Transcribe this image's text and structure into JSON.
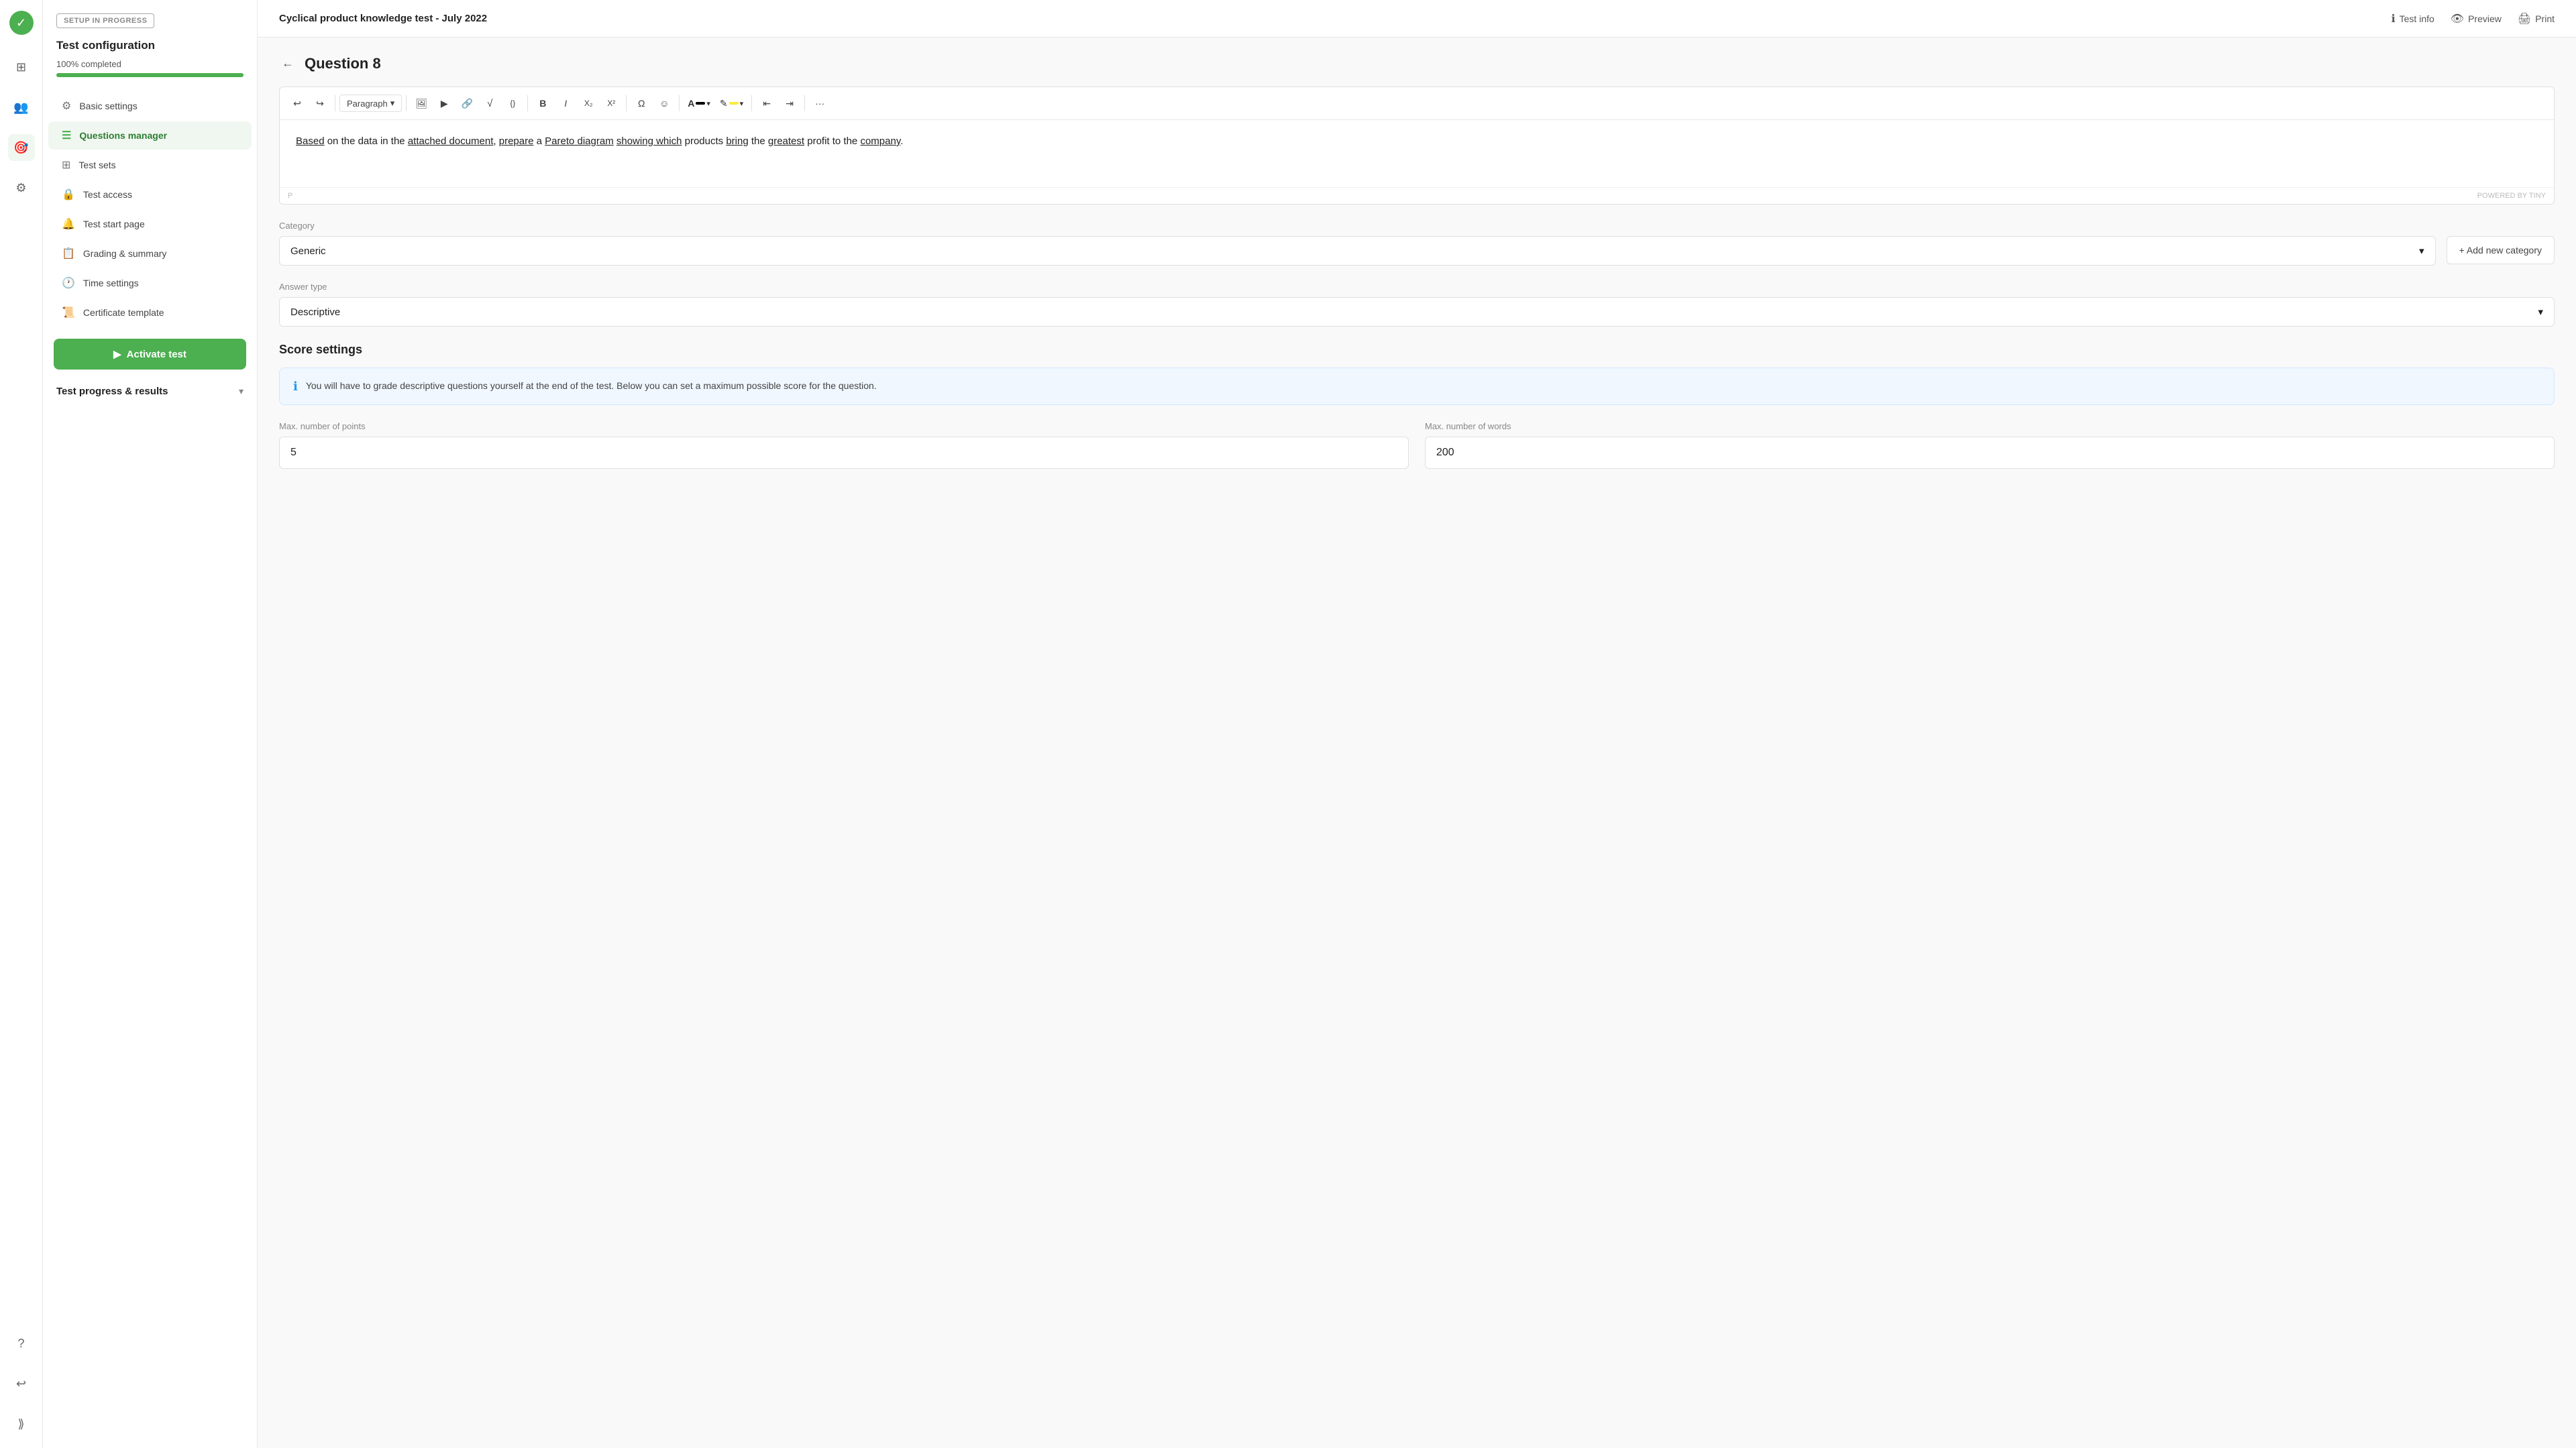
{
  "app": {
    "logo_symbol": "✓",
    "title": "Cyclical product knowledge test - July 2022"
  },
  "header": {
    "test_info_label": "Test info",
    "preview_label": "Preview",
    "print_label": "Print"
  },
  "sidebar": {
    "setup_badge": "SETUP IN PROGRESS",
    "config_title": "Test configuration",
    "progress_label": "100% completed",
    "progress_percent": 100,
    "nav_items": [
      {
        "id": "basic-settings",
        "label": "Basic settings",
        "icon": "⚙"
      },
      {
        "id": "questions-manager",
        "label": "Questions manager",
        "icon": "☰",
        "active": true
      },
      {
        "id": "test-sets",
        "label": "Test sets",
        "icon": "⊞"
      },
      {
        "id": "test-access",
        "label": "Test access",
        "icon": "🔒"
      },
      {
        "id": "test-start-page",
        "label": "Test start page",
        "icon": "🔔"
      },
      {
        "id": "grading-summary",
        "label": "Grading & summary",
        "icon": "📋"
      },
      {
        "id": "time-settings",
        "label": "Time settings",
        "icon": "🕐"
      },
      {
        "id": "certificate-template",
        "label": "Certificate template",
        "icon": "📜"
      }
    ],
    "activate_btn": "Activate test",
    "results_section": "Test progress & results"
  },
  "icons": {
    "grid": "⊞",
    "users": "👥",
    "gauge": "🎯",
    "gear": "⚙",
    "help": "?",
    "arrow_left": "←",
    "chevron_down": "▾",
    "chevron_up": "▴",
    "play": "▶",
    "expand_arrows": "⟪⟫",
    "undo": "↩",
    "redo": "↪",
    "image": "🖼",
    "video": "▶",
    "link": "🔗",
    "sqrt": "√",
    "code": "{}",
    "bold": "B",
    "italic": "I",
    "subscript": "X₂",
    "superscript": "X²",
    "omega": "Ω",
    "emoji": "☺",
    "font_color": "A",
    "highlight": "✎",
    "indent_left": "⇤",
    "indent_right": "⇥",
    "more": "···",
    "info": "ℹ",
    "plus": "+",
    "back": "←"
  },
  "question": {
    "number": "Question 8",
    "content": "Based on the data in the attached document, prepare a Pareto diagram showing which products bring the greatest profit to the company.",
    "editor_footer_left": "P",
    "editor_footer_right": "POWERED BY TINY",
    "cursor_visible": true
  },
  "form": {
    "category_label": "Category",
    "category_value": "Generic",
    "add_category_label": "+ Add new category",
    "answer_type_label": "Answer type",
    "answer_type_value": "Descriptive",
    "score_settings_title": "Score settings",
    "info_text": "You will have to grade descriptive questions yourself at the end of the test. Below you can set a maximum possible score for the question.",
    "max_points_label": "Max. number of points",
    "max_points_value": "5",
    "max_words_label": "Max. number of words",
    "max_words_value": "200"
  },
  "toolbar": {
    "paragraph_label": "Paragraph"
  }
}
